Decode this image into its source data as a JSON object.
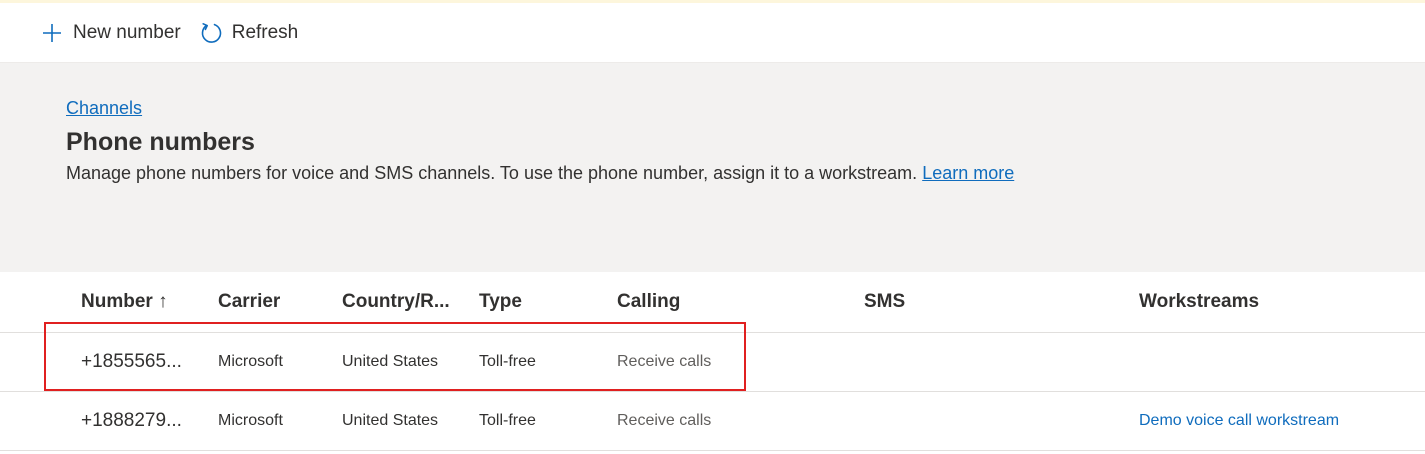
{
  "toolbar": {
    "new_number_label": "New number",
    "refresh_label": "Refresh"
  },
  "header": {
    "breadcrumb": "Channels",
    "title": "Phone numbers",
    "description": "Manage phone numbers for voice and SMS channels. To use the phone number, assign it to a workstream.",
    "learn_more": "Learn more"
  },
  "table": {
    "columns": {
      "number": "Number ↑",
      "carrier": "Carrier",
      "country": "Country/R...",
      "type": "Type",
      "calling": "Calling",
      "sms": "SMS",
      "workstreams": "Workstreams"
    },
    "rows": [
      {
        "number": "+1855565...",
        "carrier": "Microsoft",
        "country": "United States",
        "type": "Toll-free",
        "calling": "Receive calls",
        "sms": "",
        "workstreams": ""
      },
      {
        "number": "+1888279...",
        "carrier": "Microsoft",
        "country": "United States",
        "type": "Toll-free",
        "calling": "Receive calls",
        "sms": "",
        "workstreams": "Demo voice call workstream"
      }
    ]
  },
  "colors": {
    "accent": "#0f6cbd",
    "header_bg": "#f3f2f1",
    "highlight": "#e02020"
  },
  "icons": {
    "new_number": "plus-icon",
    "refresh": "refresh-icon"
  }
}
